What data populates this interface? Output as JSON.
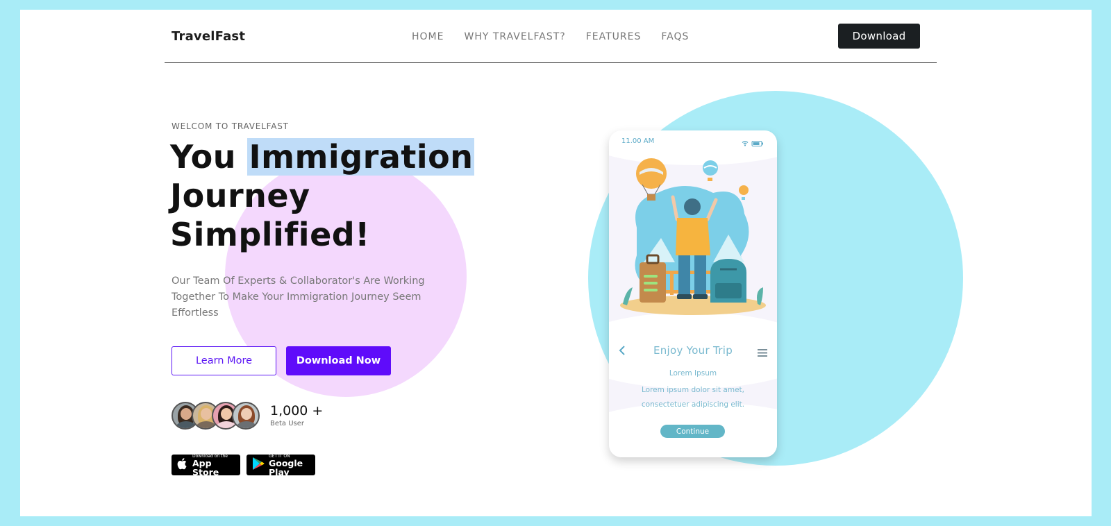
{
  "nav": {
    "brand": "TravelFast",
    "menu": [
      "HOME",
      "WHY TRAVELFAST?",
      "FEATURES",
      "FAQS"
    ],
    "cta": "Download"
  },
  "hero": {
    "eyebrow": "WELCOM TO TRAVELFAST",
    "headline_plain": "You ",
    "headline_highlight": "Immigration",
    "headline_line2": "Journey",
    "headline_line3": "Simplified!",
    "description": "Our Team Of Experts & Collaborator's Are Working Together To Make Your Immigration Journey Seem Effortless",
    "learn_more": "Learn More",
    "download_now": "Download Now",
    "user_count": "1,000 +",
    "user_count_label": "Beta User",
    "app_store_small": "Download on the",
    "app_store_big": "App Store",
    "google_play_small": "GET IT ON",
    "google_play_big": "Google Play"
  },
  "phone": {
    "time": "11.00 AM",
    "title": "Enjoy Your Trip",
    "lorem_title": "Lorem Ipsum",
    "lorem_body": "Lorem ipsum dolor sit amet, consectetuer adipiscing elit.",
    "continue": "Continue"
  },
  "colors": {
    "page_bg": "#a9ecf7",
    "accent": "#5f0cfa",
    "highlight": "#bfdcf8",
    "pink_circle": "#f4d8fd",
    "phone_accent": "#62b6c7"
  }
}
